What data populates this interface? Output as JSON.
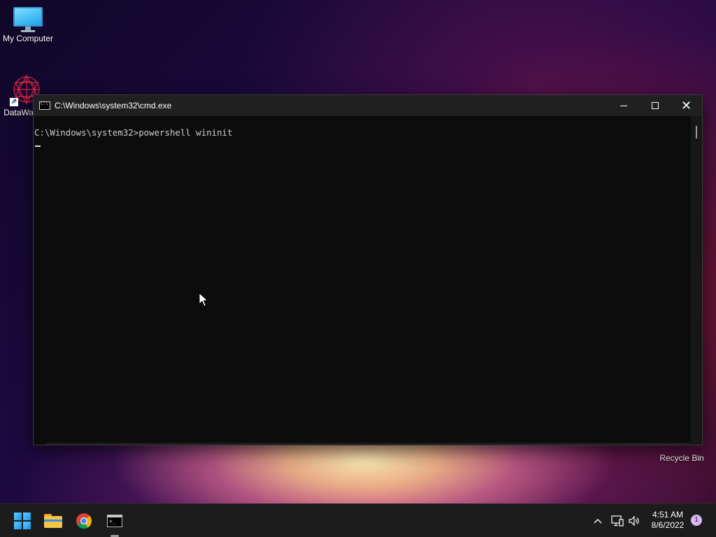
{
  "desktop": {
    "icons": [
      {
        "label": "My Computer",
        "icon": "computer-icon"
      },
      {
        "label": "DataWag",
        "icon": "datawag-icon"
      },
      {
        "label": "Recycle Bin",
        "icon": "recycle-bin-icon"
      }
    ]
  },
  "cmd_window": {
    "title": "C:\\Windows\\system32\\cmd.exe",
    "prompt_line": "C:\\Windows\\system32>powershell wininit",
    "buttons": {
      "minimize": "minimize-icon",
      "maximize": "maximize-icon",
      "close": "close-icon"
    }
  },
  "taskbar": {
    "apps": [
      "start-icon",
      "file-explorer-icon",
      "chrome-icon",
      "command-prompt-icon"
    ],
    "tray": {
      "time": "4:51 AM",
      "date": "8/6/2022",
      "notification_count": "1"
    }
  },
  "colors": {
    "console_bg": "#0c0c0c",
    "console_text": "#cccccc",
    "titlebar_bg": "#202020",
    "taskbar_bg": "#1c1c1c"
  }
}
